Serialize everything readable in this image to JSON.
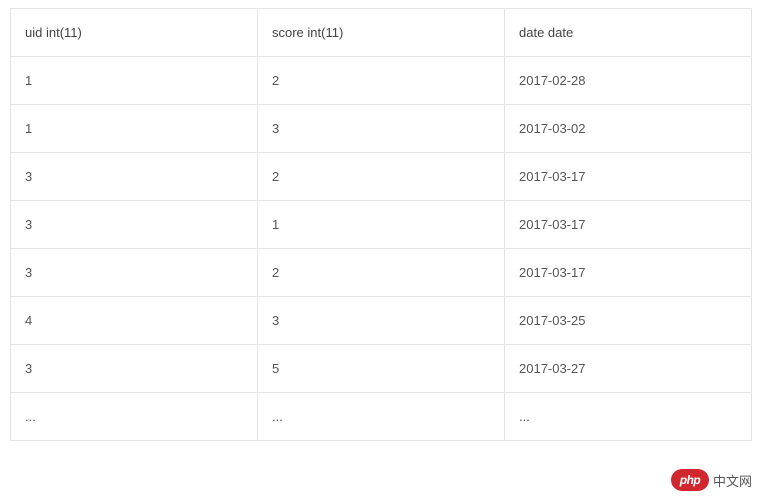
{
  "table": {
    "headers": [
      "uid int(11)",
      "score int(11)",
      "date date"
    ],
    "rows": [
      [
        "1",
        "2",
        "2017-02-28"
      ],
      [
        "1",
        "3",
        "2017-03-02"
      ],
      [
        "3",
        "2",
        "2017-03-17"
      ],
      [
        "3",
        "1",
        "2017-03-17"
      ],
      [
        "3",
        "2",
        "2017-03-17"
      ],
      [
        "4",
        "3",
        "2017-03-25"
      ],
      [
        "3",
        "5",
        "2017-03-27"
      ],
      [
        "...",
        "...",
        "..."
      ]
    ]
  },
  "watermark": {
    "logo_text": "php",
    "brand_text": "中文网"
  }
}
